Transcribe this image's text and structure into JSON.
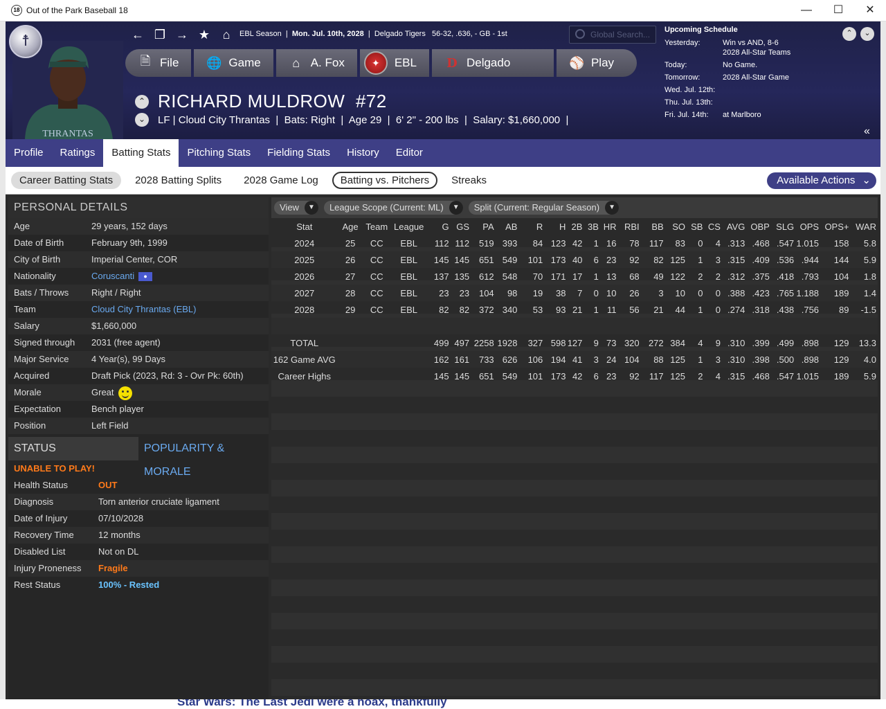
{
  "window": {
    "title": "Out of the Park Baseball 18",
    "icon": "18"
  },
  "header": {
    "season": "EBL Season",
    "date": "Mon. Jul. 10th, 2028",
    "team": "Delgado Tigers",
    "record": "56-32, .636, - GB - 1st",
    "search_placeholder": "Global Search...",
    "menu": [
      "File",
      "Game",
      "A. Fox",
      "EBL",
      "Delgado",
      "Play"
    ]
  },
  "player": {
    "name": "RICHARD MULDROW",
    "number": "#72",
    "position": "LF",
    "team": "Cloud City Thrantas",
    "bats": "Bats: Right",
    "age": "Age 29",
    "size": "6' 2\" - 200 lbs",
    "salary": "Salary: $1,660,000"
  },
  "schedule": {
    "title": "Upcoming Schedule",
    "rows": [
      {
        "label": "Yesterday:",
        "value": "Win vs AND, 8-6",
        "value2": "2028 All-Star Teams"
      },
      {
        "label": "Today:",
        "value": "No Game."
      },
      {
        "label": "Tomorrow:",
        "value": "2028 All-Star Game"
      },
      {
        "label": "Wed. Jul. 12th:",
        "value": ""
      },
      {
        "label": "Thu. Jul. 13th:",
        "value": ""
      },
      {
        "label": "Fri. Jul. 14th:",
        "value": "at Marlboro"
      }
    ]
  },
  "tabs": [
    "Profile",
    "Ratings",
    "Batting Stats",
    "Pitching Stats",
    "Fielding Stats",
    "History",
    "Editor"
  ],
  "subtabs": [
    "Career Batting Stats",
    "2028 Batting Splits",
    "2028 Game Log",
    "Batting vs. Pitchers",
    "Streaks"
  ],
  "actions_label": "Available Actions",
  "personal": {
    "title": "PERSONAL DETAILS",
    "rows": [
      {
        "k": "Age",
        "v": "29 years, 152 days"
      },
      {
        "k": "Date of Birth",
        "v": "February 9th, 1999"
      },
      {
        "k": "City of Birth",
        "v": "Imperial Center, COR"
      },
      {
        "k": "Nationality",
        "v": "Coruscanti"
      },
      {
        "k": "Bats / Throws",
        "v": "Right / Right"
      },
      {
        "k": "Team",
        "v": "Cloud City Thrantas (EBL)"
      },
      {
        "k": "Salary",
        "v": "$1,660,000"
      },
      {
        "k": "Signed through",
        "v": "2031 (free agent)"
      },
      {
        "k": "Major Service",
        "v": "4 Year(s), 99 Days"
      },
      {
        "k": "Acquired",
        "v": "Draft Pick (2023, Rd: 3 - Ovr Pk: 60th)"
      },
      {
        "k": "Morale",
        "v": "Great"
      },
      {
        "k": "Expectation",
        "v": "Bench player"
      },
      {
        "k": "Position",
        "v": "Left Field"
      }
    ]
  },
  "status": {
    "title": "STATUS",
    "alt_title": "POPULARITY & MORALE",
    "alert": "UNABLE TO PLAY!",
    "rows": [
      {
        "k": "Health Status",
        "v": "OUT"
      },
      {
        "k": "Diagnosis",
        "v": "Torn anterior cruciate ligament"
      },
      {
        "k": "Date of Injury",
        "v": "07/10/2028"
      },
      {
        "k": "Recovery Time",
        "v": "12 months"
      },
      {
        "k": "Disabled List",
        "v": "Not on DL"
      },
      {
        "k": "Injury Proneness",
        "v": "Fragile"
      },
      {
        "k": "Rest Status",
        "v": "100% - Rested"
      }
    ]
  },
  "filters": [
    "View",
    "League Scope  (Current: ML)",
    "Split  (Current: Regular Season)"
  ],
  "stats": {
    "headers": [
      "Stat",
      "Age",
      "Team",
      "League",
      "G",
      "GS",
      "PA",
      "AB",
      "R",
      "H",
      "2B",
      "3B",
      "HR",
      "RBI",
      "BB",
      "SO",
      "SB",
      "CS",
      "AVG",
      "OBP",
      "SLG",
      "OPS",
      "OPS+",
      "WAR"
    ],
    "rows": [
      [
        "2024",
        "25",
        "CC",
        "EBL",
        "112",
        "112",
        "519",
        "393",
        "84",
        "123",
        "42",
        "1",
        "16",
        "78",
        "117",
        "83",
        "0",
        "4",
        ".313",
        ".468",
        ".547",
        "1.015",
        "158",
        "5.8"
      ],
      [
        "2025",
        "26",
        "CC",
        "EBL",
        "145",
        "145",
        "651",
        "549",
        "101",
        "173",
        "40",
        "6",
        "23",
        "92",
        "82",
        "125",
        "1",
        "3",
        ".315",
        ".409",
        ".536",
        ".944",
        "144",
        "5.9"
      ],
      [
        "2026",
        "27",
        "CC",
        "EBL",
        "137",
        "135",
        "612",
        "548",
        "70",
        "171",
        "17",
        "1",
        "13",
        "68",
        "49",
        "122",
        "2",
        "2",
        ".312",
        ".375",
        ".418",
        ".793",
        "104",
        "1.8"
      ],
      [
        "2027",
        "28",
        "CC",
        "EBL",
        "23",
        "23",
        "104",
        "98",
        "19",
        "38",
        "7",
        "0",
        "10",
        "26",
        "3",
        "10",
        "0",
        "0",
        ".388",
        ".423",
        ".765",
        "1.188",
        "189",
        "1.4"
      ],
      [
        "2028",
        "29",
        "CC",
        "EBL",
        "82",
        "82",
        "372",
        "340",
        "53",
        "93",
        "21",
        "1",
        "11",
        "56",
        "21",
        "44",
        "1",
        "0",
        ".274",
        ".318",
        ".438",
        ".756",
        "89",
        "-1.5"
      ],
      [
        "",
        "",
        "",
        "",
        "",
        "",
        "",
        "",
        "",
        "",
        "",
        "",
        "",
        "",
        "",
        "",
        "",
        "",
        "",
        "",
        "",
        "",
        "",
        ""
      ],
      [
        "TOTAL",
        "",
        "",
        "",
        "499",
        "497",
        "2258",
        "1928",
        "327",
        "598",
        "127",
        "9",
        "73",
        "320",
        "272",
        "384",
        "4",
        "9",
        ".310",
        ".399",
        ".499",
        ".898",
        "129",
        "13.3"
      ],
      [
        "162 Game AVG",
        "",
        "",
        "",
        "162",
        "161",
        "733",
        "626",
        "106",
        "194",
        "41",
        "3",
        "24",
        "104",
        "88",
        "125",
        "1",
        "3",
        ".310",
        ".398",
        ".500",
        ".898",
        "129",
        "4.0"
      ],
      [
        "Career Highs",
        "",
        "",
        "",
        "145",
        "145",
        "651",
        "549",
        "101",
        "173",
        "42",
        "6",
        "23",
        "92",
        "117",
        "125",
        "2",
        "4",
        ".315",
        ".468",
        ".547",
        "1.015",
        "189",
        "5.9"
      ]
    ]
  },
  "bottom_text": "Star Wars: The Last Jedi were a hoax, thankfully"
}
